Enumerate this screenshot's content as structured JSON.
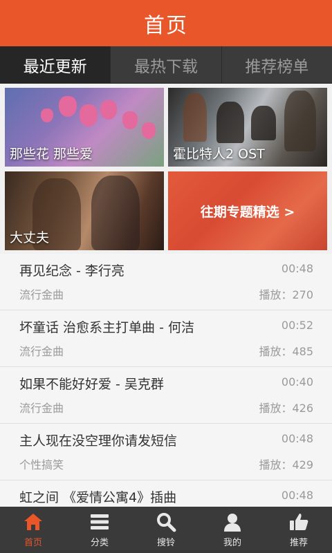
{
  "header": {
    "title": "首页"
  },
  "tabs": [
    {
      "label": "最近更新",
      "active": true
    },
    {
      "label": "最热下载",
      "active": false
    },
    {
      "label": "推荐榜单",
      "active": false
    }
  ],
  "banners": [
    {
      "caption": "那些花 那些爱"
    },
    {
      "caption": "霍比特人2 OST"
    },
    {
      "caption": "大丈夫"
    },
    {
      "caption": "往期专题精选 >"
    }
  ],
  "songs": [
    {
      "title": "再见纪念 - 李行亮",
      "duration": "00:48",
      "genre": "流行金曲",
      "plays": "播放：270"
    },
    {
      "title": "坏童话 治愈系主打单曲 - 何洁",
      "duration": "00:52",
      "genre": "流行金曲",
      "plays": "播放：485"
    },
    {
      "title": "如果不能好好爱 - 吴克群",
      "duration": "00:40",
      "genre": "流行金曲",
      "plays": "播放：426"
    },
    {
      "title": "主人现在没空理你请发短信",
      "duration": "00:48",
      "genre": "个性搞笑",
      "plays": "播放：429"
    },
    {
      "title": "虹之间 《爱情公寓4》插曲",
      "duration": "00:48",
      "genre": "",
      "plays": ""
    }
  ],
  "bottom_nav": [
    {
      "label": "首页",
      "icon": "home-icon",
      "active": true
    },
    {
      "label": "分类",
      "icon": "menu-icon",
      "active": false
    },
    {
      "label": "搜铃",
      "icon": "search-icon",
      "active": false
    },
    {
      "label": "我的",
      "icon": "user-icon",
      "active": false
    },
    {
      "label": "推荐",
      "icon": "thumbs-up-icon",
      "active": false
    }
  ],
  "colors": {
    "accent": "#e8562a",
    "tabbar": "#3b3b3b",
    "bottombar": "#3a3a3a"
  }
}
